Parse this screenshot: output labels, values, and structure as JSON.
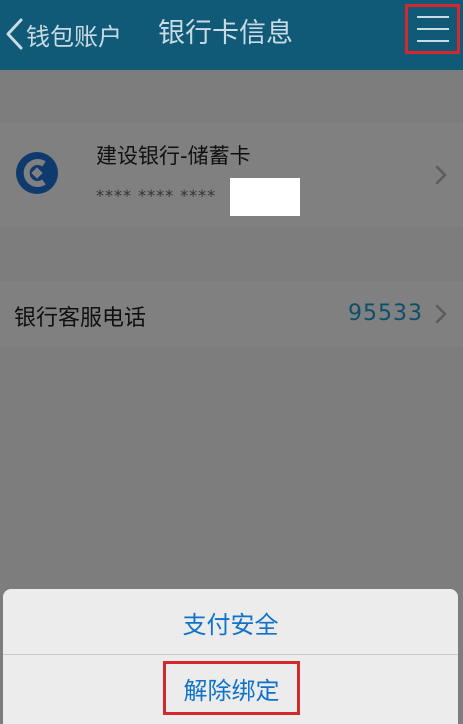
{
  "nav": {
    "back_label": "钱包账户",
    "title": "银行卡信息",
    "menu_icon": "hamburger-menu-icon",
    "highlight_color": "#d2282e"
  },
  "card": {
    "bank_name": "建设银行-储蓄卡",
    "masked_number": "**** **** ****",
    "logo_icon": "ccb-bank-logo-icon",
    "logo_color": "#0f3a6e"
  },
  "hotline": {
    "label": "银行客服电话",
    "number": "95533"
  },
  "action_sheet": {
    "items": [
      {
        "label": "支付安全"
      },
      {
        "label": "解除绑定"
      }
    ],
    "accent": "#1172c9"
  }
}
